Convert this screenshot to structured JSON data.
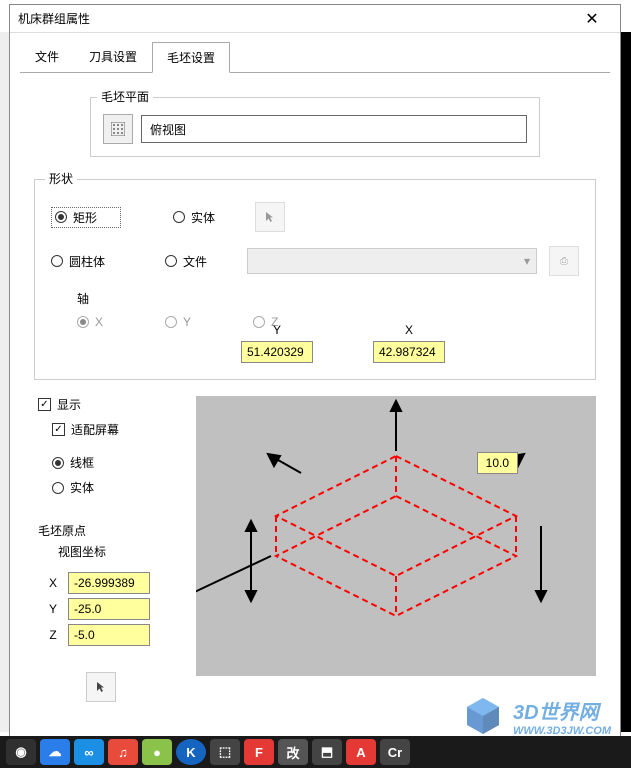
{
  "window": {
    "title": "机床群组属性"
  },
  "tabs": {
    "file": "文件",
    "tool": "刀具设置",
    "stock": "毛坯设置",
    "activeIndex": 2
  },
  "plane": {
    "label": "毛坯平面",
    "value": "俯视图"
  },
  "shape": {
    "label": "形状",
    "rect": "矩形",
    "solid": "实体",
    "cylinder": "圆柱体",
    "fileOpt": "文件",
    "axisLabel": "轴",
    "axisX": "X",
    "axisY": "Y",
    "axisZ": "Z",
    "yLabel": "Y",
    "xLabel": "X",
    "yVal": "51.420329",
    "xVal": "42.987324"
  },
  "display": {
    "show": "显示",
    "fit": "适配屏幕",
    "wire": "线框",
    "solidView": "实体"
  },
  "origin": {
    "label": "毛坯原点",
    "viewCoord": "视图坐标",
    "x": "X",
    "y": "Y",
    "z": "Z",
    "xv": "-26.999389",
    "yv": "-25.0",
    "zv": "-5.0"
  },
  "preview": {
    "height": "10.0"
  },
  "watermark": {
    "text": "3D世界网",
    "url": "WWW.3D3JW.COM"
  }
}
